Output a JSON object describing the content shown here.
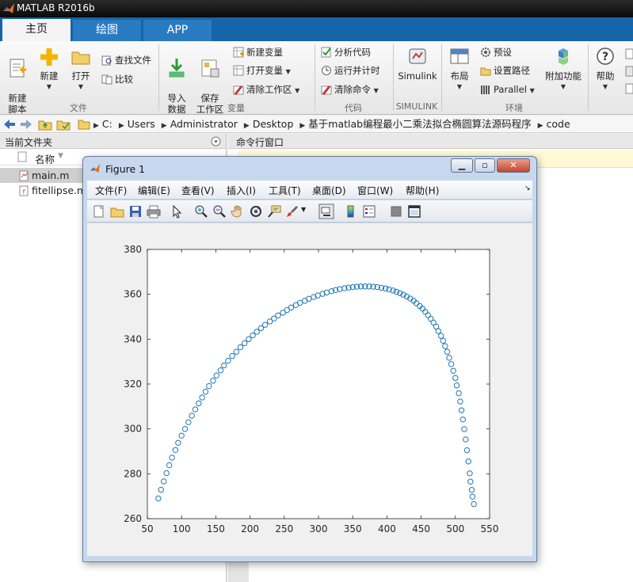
{
  "app": {
    "title": "MATLAB R2016b"
  },
  "tabs": [
    {
      "label": "主页",
      "active": true
    },
    {
      "label": "绘图",
      "active": false
    },
    {
      "label": "APP",
      "active": false
    }
  ],
  "ribbon": {
    "file": {
      "new_script": "新建\n脚本",
      "new": "新建",
      "open": "打开",
      "find_files": "查找文件",
      "compare": "比较",
      "group_label": "文件"
    },
    "variable": {
      "import": "导入\n数据",
      "save_workspace": "保存\n工作区",
      "new_variable": "新建变量",
      "open_variable": "打开变量",
      "clear_workspace": "清除工作区",
      "group_label": "变量"
    },
    "code": {
      "analyze": "分析代码",
      "run_time": "运行并计时",
      "clear_commands": "清除命令",
      "group_label": "代码"
    },
    "simulink": {
      "label": "Simulink",
      "group_label": "SIMULINK"
    },
    "env": {
      "layout": "布局",
      "preferences": "预设",
      "set_path": "设置路径",
      "parallel": "Parallel",
      "addons": "附加功能",
      "group_label": "环境"
    },
    "help": {
      "label": "帮助"
    }
  },
  "address": {
    "crumbs": [
      "C:",
      "Users",
      "Administrator",
      "Desktop",
      "基于matlab编程最小二乘法拟合椭圆算法源码程序",
      "code"
    ]
  },
  "current_folder": {
    "title": "当前文件夹",
    "column_name": "名称",
    "files": [
      {
        "name": "main.m",
        "selected": true
      },
      {
        "name": "fitellipse.m",
        "selected": false
      }
    ]
  },
  "command_window": {
    "title": "命令行窗口"
  },
  "figure": {
    "title": "Figure 1",
    "menu": [
      "文件(F)",
      "编辑(E)",
      "查看(V)",
      "插入(I)",
      "工具(T)",
      "桌面(D)",
      "窗口(W)",
      "帮助(H)"
    ],
    "toolbar_icons": [
      "new-figure-icon",
      "open-file-icon",
      "save-icon",
      "print-icon",
      "pointer-icon",
      "zoom-in-icon",
      "zoom-out-icon",
      "pan-icon",
      "rotate-3d-icon",
      "data-cursor-icon",
      "brush-icon",
      "link-plot-icon",
      "colorbar-icon",
      "legend-icon",
      "hide-plot-tools-icon",
      "show-plot-tools-icon"
    ]
  },
  "chart_data": {
    "type": "scatter",
    "marker": "circle",
    "color": "#1f77b4",
    "title": "",
    "xlabel": "",
    "ylabel": "",
    "xlim": [
      50,
      550
    ],
    "ylim": [
      260,
      380
    ],
    "xticks": [
      50,
      100,
      150,
      200,
      250,
      300,
      350,
      400,
      450,
      500,
      550
    ],
    "yticks": [
      260,
      280,
      300,
      320,
      340,
      360,
      380
    ],
    "grid": false,
    "series": [
      {
        "x": [
          66,
          70,
          74,
          78,
          82,
          86,
          91,
          95,
          100,
          105,
          110,
          115,
          120,
          125,
          130,
          135,
          140,
          146,
          151,
          157,
          162,
          168,
          174,
          180,
          186,
          192,
          198,
          204,
          210,
          216,
          222,
          229,
          235,
          241,
          248,
          254,
          260,
          267,
          273,
          280,
          286,
          293,
          299,
          306,
          312,
          319,
          325,
          331,
          338,
          344,
          350,
          356,
          362,
          368,
          374,
          380,
          386,
          392,
          398,
          403,
          409,
          414,
          419,
          424,
          429,
          434,
          439,
          443,
          448,
          452,
          456,
          460,
          464,
          468,
          472,
          475,
          479,
          482,
          485,
          488,
          491,
          494,
          497,
          500,
          502,
          505,
          507,
          509,
          511,
          513,
          515,
          517,
          519,
          521,
          522,
          524,
          525,
          527
        ],
        "y": [
          269.0,
          272.9,
          276.6,
          280.3,
          283.8,
          287.2,
          290.6,
          293.8,
          297.0,
          300.0,
          303.0,
          305.9,
          308.7,
          311.4,
          314.0,
          316.6,
          319.1,
          321.5,
          323.8,
          326.1,
          328.3,
          330.4,
          332.5,
          334.4,
          336.4,
          338.2,
          340.0,
          341.7,
          343.3,
          344.9,
          346.4,
          347.9,
          349.2,
          350.6,
          351.8,
          353.0,
          354.1,
          355.2,
          356.2,
          357.1,
          358.0,
          358.8,
          359.5,
          360.2,
          360.8,
          361.4,
          361.9,
          362.3,
          362.7,
          363.0,
          363.2,
          363.4,
          363.5,
          363.5,
          363.5,
          363.4,
          363.2,
          362.9,
          362.6,
          362.2,
          361.7,
          361.1,
          360.5,
          359.8,
          359.0,
          358.1,
          357.1,
          356.0,
          354.8,
          353.6,
          352.2,
          350.7,
          349.1,
          347.4,
          345.6,
          343.6,
          341.5,
          339.3,
          336.9,
          334.4,
          331.7,
          328.9,
          325.9,
          322.7,
          319.4,
          315.9,
          312.2,
          308.3,
          304.2,
          299.9,
          295.3,
          290.5,
          285.5,
          280.2,
          276.5,
          272.8,
          269.8,
          266.5
        ]
      }
    ]
  }
}
